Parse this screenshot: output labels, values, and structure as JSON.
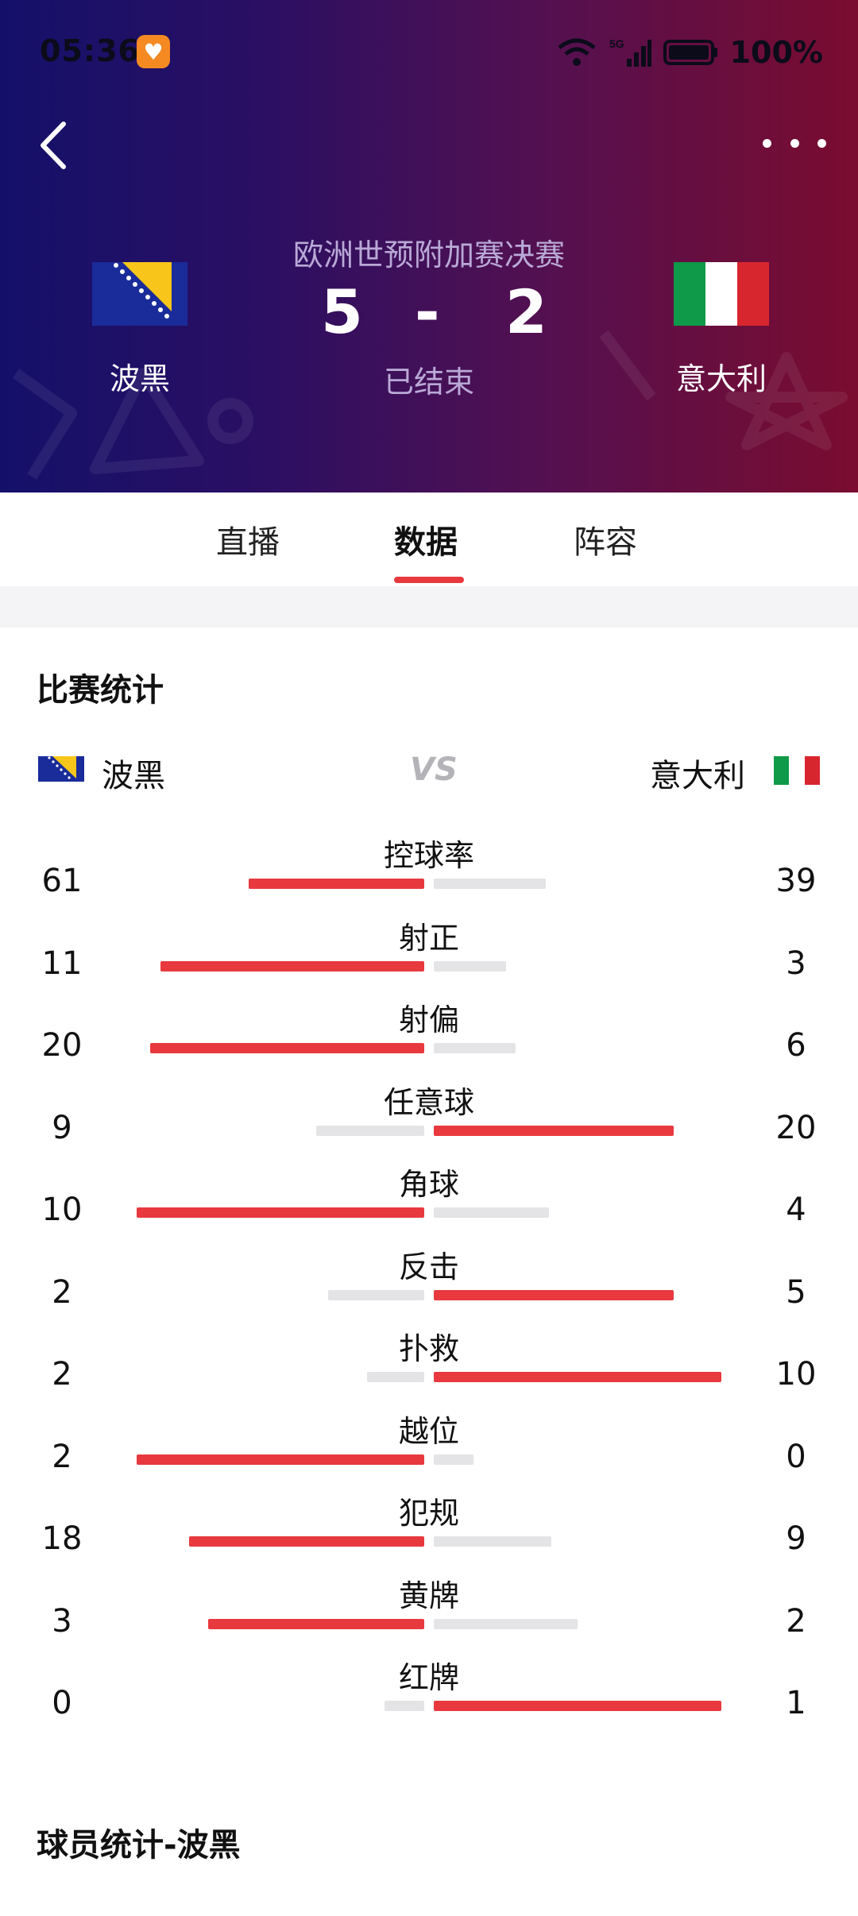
{
  "status_bar": {
    "time": "05:36",
    "app_icon": "heart-app-icon",
    "network": "5G",
    "battery": "100%"
  },
  "header": {
    "competition": "欧洲世预附加赛决赛",
    "home": {
      "name": "波黑",
      "score": "5",
      "flag": "bosnia-flag"
    },
    "away": {
      "name": "意大利",
      "score": "2",
      "flag": "italy-flag"
    },
    "score_separator": "-",
    "status": "已结束"
  },
  "tabs": [
    {
      "label": "直播",
      "active": false
    },
    {
      "label": "数据",
      "active": true
    },
    {
      "label": "阵容",
      "active": false
    }
  ],
  "match_stats": {
    "title": "比赛统计",
    "home_name": "波黑",
    "away_name": "意大利",
    "vs": "VS",
    "rows": [
      {
        "label": "控球率",
        "home": "61",
        "away": "39",
        "home_value": 61,
        "away_value": 39,
        "bar_max": 100
      },
      {
        "label": "射正",
        "home": "11",
        "away": "3",
        "home_value": 11,
        "away_value": 3,
        "bar_max": 12
      },
      {
        "label": "射偏",
        "home": "20",
        "away": "6",
        "home_value": 20,
        "away_value": 6,
        "bar_max": 21
      },
      {
        "label": "任意球",
        "home": "9",
        "away": "20",
        "home_value": 9,
        "away_value": 20,
        "bar_max": 24
      },
      {
        "label": "角球",
        "home": "10",
        "away": "4",
        "home_value": 10,
        "away_value": 4,
        "bar_max": 10
      },
      {
        "label": "反击",
        "home": "2",
        "away": "5",
        "home_value": 2,
        "away_value": 5,
        "bar_max": 6
      },
      {
        "label": "扑救",
        "home": "2",
        "away": "10",
        "home_value": 2,
        "away_value": 10,
        "bar_max": 10
      },
      {
        "label": "越位",
        "home": "2",
        "away": "0",
        "home_value": 2,
        "away_value": 0,
        "bar_max": 2
      },
      {
        "label": "犯规",
        "home": "18",
        "away": "9",
        "home_value": 18,
        "away_value": 9,
        "bar_max": 22
      },
      {
        "label": "黄牌",
        "home": "3",
        "away": "2",
        "home_value": 3,
        "away_value": 2,
        "bar_max": 4
      },
      {
        "label": "红牌",
        "home": "0",
        "away": "1",
        "home_value": 0,
        "away_value": 1,
        "bar_max": 1
      }
    ]
  },
  "player_stats": {
    "title": "球员统计-波黑"
  },
  "colors": {
    "accent": "#e8393f",
    "bar_background": "#e4e4e6",
    "header_start": "#14106a",
    "header_end": "#7a0c2f"
  }
}
